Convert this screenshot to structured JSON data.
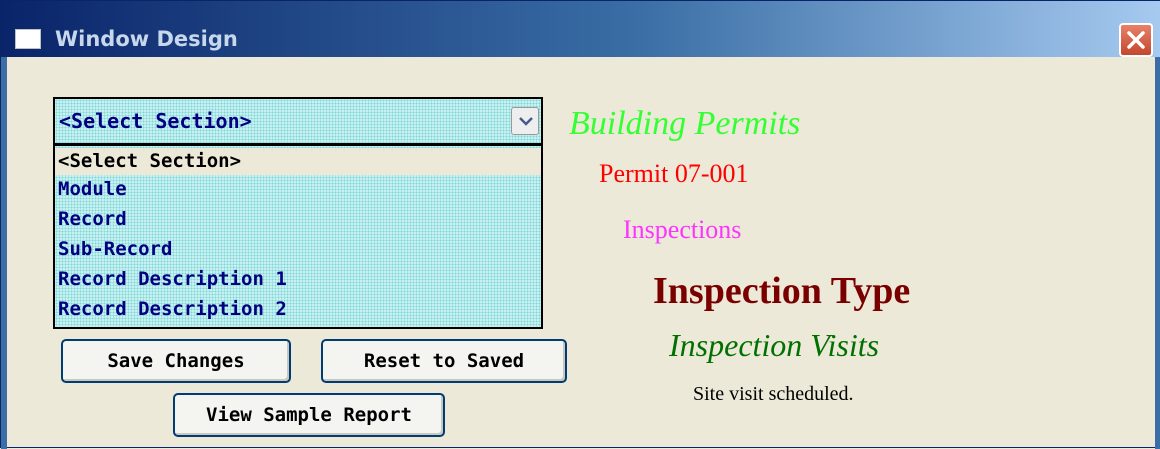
{
  "window": {
    "title": "Window Design",
    "icons": {
      "app": "window-icon",
      "close": "close-icon"
    }
  },
  "section_select": {
    "value": "<Select Section>",
    "arrow_icon": "chevron-down-icon",
    "options": [
      {
        "label": "<Select Section>",
        "selected": true
      },
      {
        "label": "Module",
        "selected": false
      },
      {
        "label": "Record",
        "selected": false
      },
      {
        "label": "Sub-Record",
        "selected": false
      },
      {
        "label": "Record Description 1",
        "selected": false
      },
      {
        "label": "Record Description 2",
        "selected": false
      }
    ]
  },
  "buttons": {
    "save": "Save Changes",
    "reset": "Reset to Saved",
    "report": "View Sample Report"
  },
  "preview": {
    "module": "Building Permits",
    "record": "Permit 07-001",
    "sub_record": "Inspections",
    "record_description_1": "Inspection Type",
    "record_description_2": "Inspection Visits",
    "detail": "Site visit scheduled."
  },
  "colors": {
    "list_background": "#c8f0f0",
    "list_text": "#000080",
    "module": "#33ff33",
    "record": "#ff0000",
    "sub_record": "#ff33ff",
    "record_description_1": "#7a0000",
    "record_description_2": "#007000",
    "detail": "#000000"
  }
}
